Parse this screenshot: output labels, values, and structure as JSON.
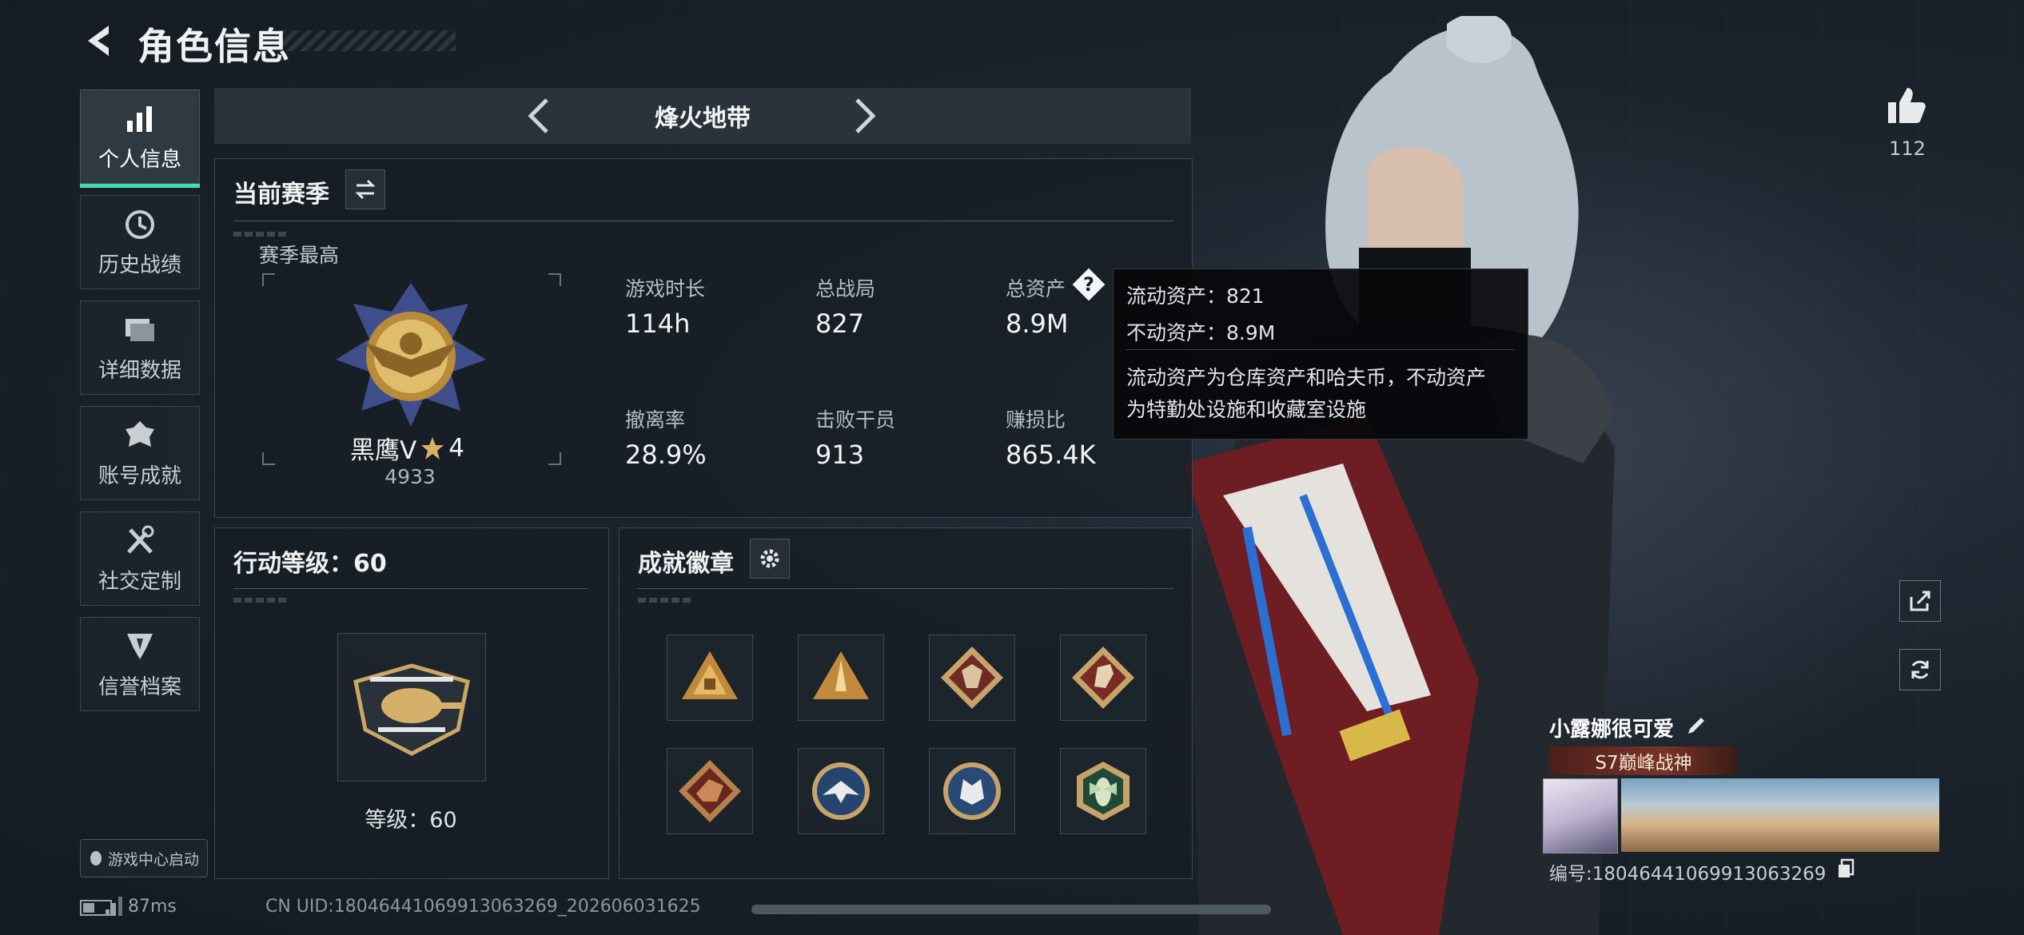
{
  "header": {
    "title": "角色信息"
  },
  "sidebar": {
    "items": [
      {
        "label": "个人信息",
        "icon": "bar-chart-icon",
        "active": true
      },
      {
        "label": "历史战绩",
        "icon": "clock-icon",
        "active": false
      },
      {
        "label": "详细数据",
        "icon": "folder-icon",
        "active": false
      },
      {
        "label": "账号成就",
        "icon": "medal-icon",
        "active": false
      },
      {
        "label": "社交定制",
        "icon": "tools-icon",
        "active": false
      },
      {
        "label": "信誉档案",
        "icon": "shield-icon",
        "active": false
      }
    ],
    "launch_label": "游戏中心启动"
  },
  "mode_nav": {
    "label": "烽火地带"
  },
  "season": {
    "heading": "当前赛季",
    "best_label": "赛季最高",
    "rank_name": "黑鹰V",
    "rank_stars": "4",
    "rank_points": "4933",
    "stats": [
      {
        "label": "游戏时长",
        "value": "114h"
      },
      {
        "label": "总战局",
        "value": "827"
      },
      {
        "label": "总资产",
        "value": "8.9M"
      },
      {
        "label": "撤离率",
        "value": "28.9%"
      },
      {
        "label": "击败干员",
        "value": "913"
      },
      {
        "label": "赚损比",
        "value": "865.4K"
      }
    ]
  },
  "tooltip": {
    "line1": "流动资产：821",
    "line2": "不动资产：8.9M",
    "desc1": "流动资产为仓库资产和哈夫币，不动资产",
    "desc2": "为特勤处设施和收藏室设施"
  },
  "action_level": {
    "heading": "行动等级：60",
    "level_text": "等级：60"
  },
  "badges": {
    "heading": "成就徽章",
    "items": [
      "triangle-badge-1",
      "triangle-badge-2",
      "wolf-diamond-badge",
      "horse-diamond-badge",
      "dragon-diamond-badge",
      "eagle-round-badge",
      "wolf-round-badge",
      "hornet-hex-badge"
    ]
  },
  "profile": {
    "likes": "112",
    "player_name": "小露娜很可爱",
    "title_badge": "S7巅峰战神",
    "id_text": "编号:1804644106991306326​9"
  },
  "footer": {
    "ping": "87ms",
    "uid": "CN UID:1804644106991306326​9_202606031625"
  },
  "colors": {
    "accent": "#3fe0b0",
    "gold": "#d9b061",
    "panel": "#1b232b"
  }
}
